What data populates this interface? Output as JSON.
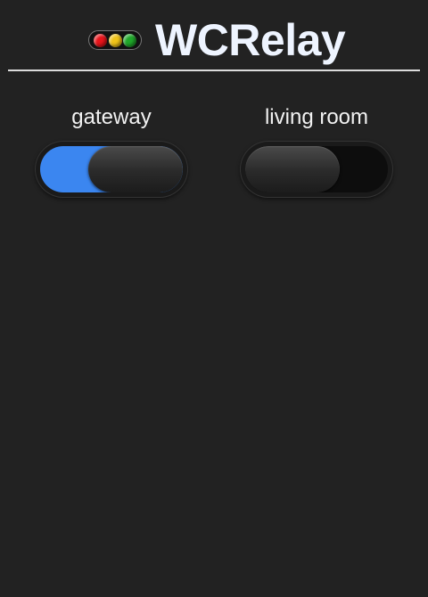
{
  "app": {
    "title": "WCRelay",
    "logo_icon": "traffic-light-icon",
    "logo_colors": [
      "#e8141a",
      "#f0c419",
      "#1fa82a"
    ]
  },
  "colors": {
    "background": "#222222",
    "accent_on": "#3b86f0",
    "track_off": "#0d0d0d"
  },
  "relays": [
    {
      "label": "gateway",
      "state": "on"
    },
    {
      "label": "living room",
      "state": "off"
    }
  ]
}
